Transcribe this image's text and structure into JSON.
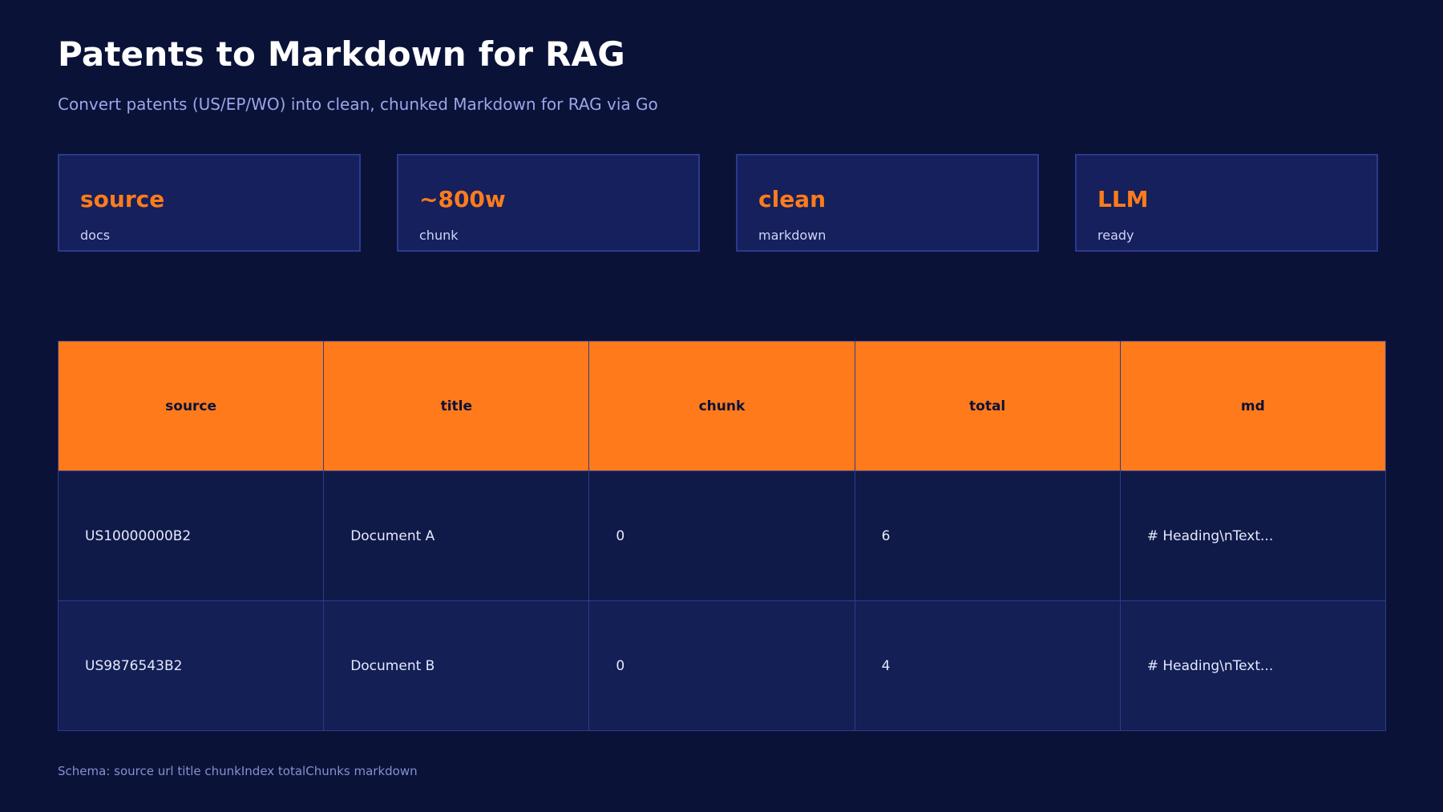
{
  "header": {
    "title": "Patents to Markdown for RAG",
    "subtitle": "Convert patents (US/EP/WO) into clean, chunked Markdown for RAG via Go"
  },
  "stats": [
    {
      "value": "source",
      "label": "docs"
    },
    {
      "value": "~800w",
      "label": "chunk"
    },
    {
      "value": "clean",
      "label": "markdown"
    },
    {
      "value": "LLM",
      "label": "ready"
    }
  ],
  "table": {
    "columns": [
      "source",
      "title",
      "chunk",
      "total",
      "md"
    ],
    "rows": [
      [
        "US10000000B2",
        "Document A",
        "0",
        "6",
        "# Heading\\nText..."
      ],
      [
        "US9876543B2",
        "Document B",
        "0",
        "4",
        "# Heading\\nText..."
      ]
    ]
  },
  "footer": {
    "schema_note": "Schema: source url title chunkIndex totalChunks markdown"
  },
  "colors": {
    "background": "#0b1238",
    "card": "#15205c",
    "card_border": "#2b3a8e",
    "accent": "#ff7b1c",
    "subtitle": "#9aa6e8"
  }
}
